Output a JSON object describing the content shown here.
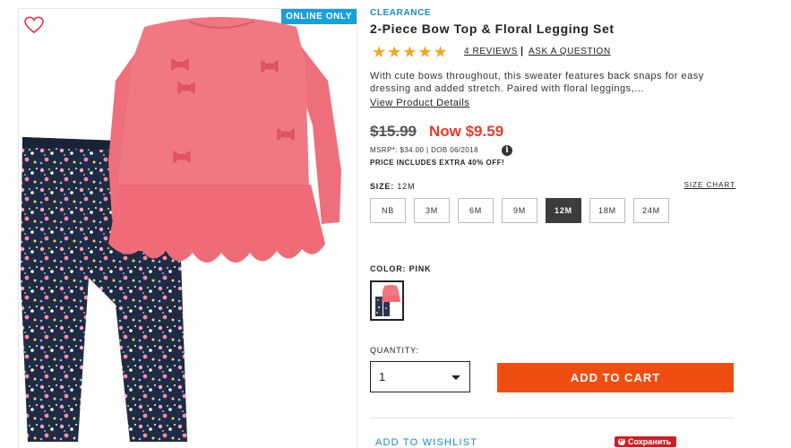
{
  "image_panel": {
    "badge": "ONLINE ONLY"
  },
  "product": {
    "tag": "CLEARANCE",
    "title": "2-Piece Bow Top & Floral Legging Set",
    "rating": 5,
    "stars": "★★★★★",
    "reviews_label": "4 REVIEWS",
    "separator": "|",
    "ask_label": "ASK A QUESTION",
    "description": "With cute bows throughout, this sweater features back snaps for easy dressing and added stretch. Paired with floral leggings,...",
    "view_details": "View Product Details"
  },
  "pricing": {
    "old_price": "$15.99",
    "now_price": "Now $9.59",
    "msrp_line": "MSRP*: $34.00 | DOB 06/2018",
    "info_glyph": "i",
    "extra_off": "PRICE INCLUDES EXTRA 40% OFF!"
  },
  "size": {
    "label": "SIZE:",
    "selected": "12M",
    "chart_link": "SIZE CHART",
    "options": [
      "NB",
      "3M",
      "6M",
      "9M",
      "12M",
      "18M",
      "24M"
    ],
    "selected_index": 4
  },
  "color": {
    "label": "COLOR:",
    "selected": "PINK"
  },
  "quantity": {
    "label": "QUANTITY:",
    "value": "1"
  },
  "actions": {
    "add_to_cart": "ADD TO CART",
    "add_to_wishlist": "ADD TO WISHLIST",
    "pinterest_save": "Сохранить",
    "pinterest_glyph": "P"
  },
  "colors": {
    "accent_blue": "#1aa0d8",
    "sale_red": "#e73b2b",
    "cart_orange": "#f04d12",
    "star_gold": "#f5a623",
    "pinterest_red": "#cb2027",
    "product_pink": "#ee6f7c"
  }
}
